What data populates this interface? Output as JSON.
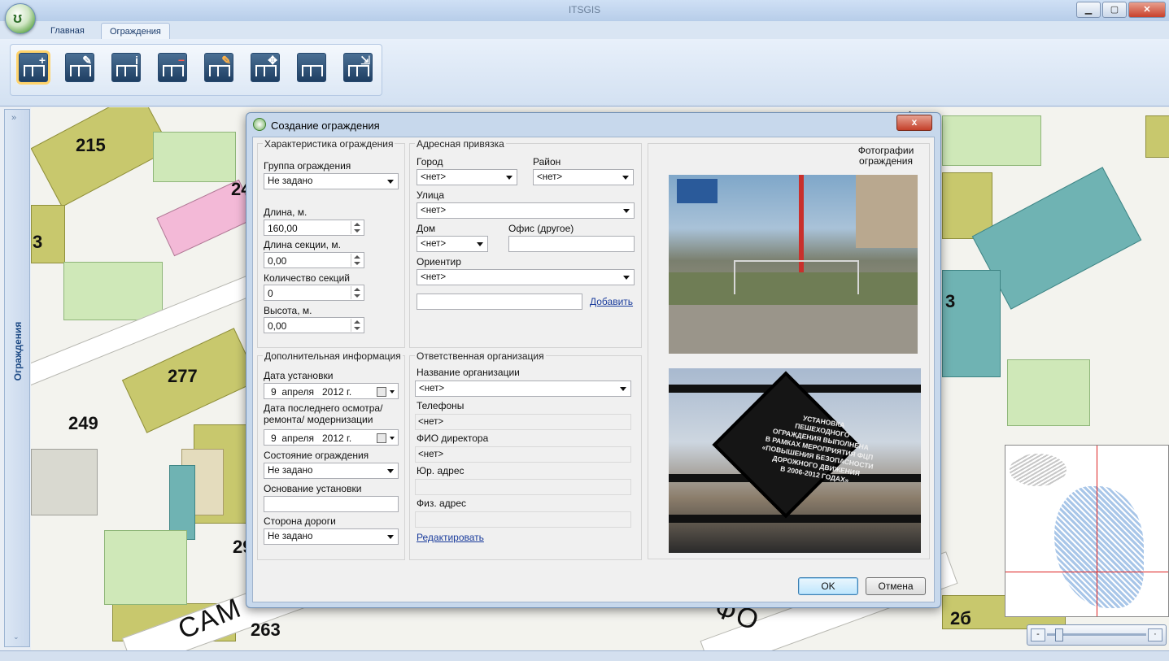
{
  "window": {
    "title": "ITSGIS",
    "minimize": "▁",
    "maximize": "▢",
    "close": "✕"
  },
  "tabs": [
    {
      "label": "Главная"
    },
    {
      "label": "Ограждения"
    }
  ],
  "sidebar": {
    "label": "Ограждения",
    "expand": "»",
    "collapse": "⌄"
  },
  "map": {
    "labels": [
      "215",
      "277",
      "249",
      "3",
      "263",
      "2б",
      "3",
      "24",
      "29"
    ],
    "street_left": "САМ",
    "street_right": "ФО",
    "street_top": "Л"
  },
  "dialog": {
    "title": "Создание ограждения",
    "close": "x",
    "fence": {
      "title": "Характеристика ограждения",
      "group_label": "Группа ограждения",
      "group_value": "Не задано",
      "length_label": "Длина, м.",
      "length_value": "160,00",
      "section_length_label": "Длина секции, м.",
      "section_length_value": "0,00",
      "sections_label": "Количество секций",
      "sections_value": "0",
      "height_label": "Высота, м.",
      "height_value": "0,00"
    },
    "address": {
      "title": "Адресная привязка",
      "city_label": "Город",
      "city_value": "<нет>",
      "district_label": "Район",
      "district_value": "<нет>",
      "street_label": "Улица",
      "street_value": "<нет>",
      "house_label": "Дом",
      "house_value": "<нет>",
      "office_label": "Офис (другое)",
      "office_value": "",
      "landmark_label": "Ориентир",
      "landmark_value": "<нет>",
      "extra_value": "",
      "add_link": "Добавить"
    },
    "photos": {
      "title": "Фотографии ограждения"
    },
    "additional": {
      "title": "Дополнительная информация",
      "install_date_label": "Дата установки",
      "install_date_value": "9  апреля   2012 г.",
      "inspection_label": "Дата последнего осмотра/ ремонта/ модернизации",
      "inspection_value": "9  апреля   2012 г.",
      "state_label": "Состояние ограждения",
      "state_value": "Не задано",
      "basis_label": "Основание установки",
      "basis_value": "",
      "side_label": "Сторона дороги",
      "side_value": "Не задано"
    },
    "org": {
      "title": "Ответственная организация",
      "name_label": "Название организации",
      "name_value": "<нет>",
      "phones_label": "Телефоны",
      "phones_value": "<нет>",
      "director_label": "ФИО директора",
      "director_value": "<нет>",
      "legal_label": "Юр. адрес",
      "legal_value": "",
      "physical_label": "Физ. адрес",
      "physical_value": "",
      "edit_link": "Редактировать"
    },
    "ok": "OK",
    "cancel": "Отмена"
  },
  "colors": {
    "accent": "#1d4a85",
    "link": "#1a3c9c",
    "close": "#c4402a"
  },
  "icons": [
    "app-orb-icon",
    "fence-add-icon",
    "fence-edit-icon",
    "fence-info-icon",
    "fence-delete-icon",
    "fence-pen-icon",
    "fence-move-icon",
    "fence-icon",
    "fence-export-icon"
  ]
}
